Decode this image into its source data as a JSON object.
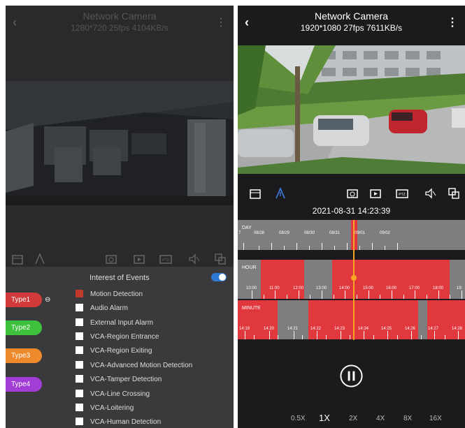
{
  "left": {
    "header": {
      "title": "Network Camera",
      "subtitle": "1280*720  25fps  4104KB/s"
    },
    "events": {
      "title": "Interest of Events",
      "toggle_on": true,
      "types": [
        {
          "label": "Type1",
          "color": "#d03a3a"
        },
        {
          "label": "Type2",
          "color": "#3ec23e"
        },
        {
          "label": "Type3",
          "color": "#ef8a2c"
        },
        {
          "label": "Type4",
          "color": "#a23ed6"
        }
      ],
      "items": [
        {
          "label": "Motion Detection",
          "checked": true
        },
        {
          "label": "Audio Alarm",
          "checked": false
        },
        {
          "label": "External Input Alarm",
          "checked": false
        },
        {
          "label": "VCA-Region Entrance",
          "checked": false
        },
        {
          "label": "VCA-Region Exiting",
          "checked": false
        },
        {
          "label": "VCA-Advanced Motion Detection",
          "checked": false
        },
        {
          "label": "VCA-Tamper Detection",
          "checked": false
        },
        {
          "label": "VCA-Line Crossing",
          "checked": false
        },
        {
          "label": "VCA-Loitering",
          "checked": false
        },
        {
          "label": "VCA-Human Detection",
          "checked": false
        }
      ]
    }
  },
  "right": {
    "header": {
      "title": "Network Camera",
      "subtitle": "1920*1080  27fps  7611KB/s"
    },
    "datetime": "2021-08-31 14:23:39",
    "timeline": {
      "day": {
        "label": "DAY",
        "ticks": [
          "7",
          "08/28",
          "08/29",
          "08/30",
          "08/31",
          "09/01",
          "09/02"
        ]
      },
      "hour": {
        "label": "HOUR",
        "ticks": [
          "10:00",
          "11:00",
          "12:00",
          "13:00",
          "14:00",
          "15:00",
          "16:00",
          "17:00",
          "18:00",
          "19:"
        ]
      },
      "minute": {
        "label": "MINUTE",
        "ticks": [
          "14:19",
          "14:20",
          "14:21",
          "14:22",
          "14:23",
          "14:24",
          "14:25",
          "14:26",
          "14:27",
          "14:28"
        ]
      }
    },
    "speeds": [
      "0.5X",
      "1X",
      "2X",
      "4X",
      "8X",
      "16X"
    ],
    "selected_speed": "1X",
    "colors": {
      "record": "#e0383d",
      "gap": "#7e7e80",
      "cursor": "#f5a623"
    }
  }
}
